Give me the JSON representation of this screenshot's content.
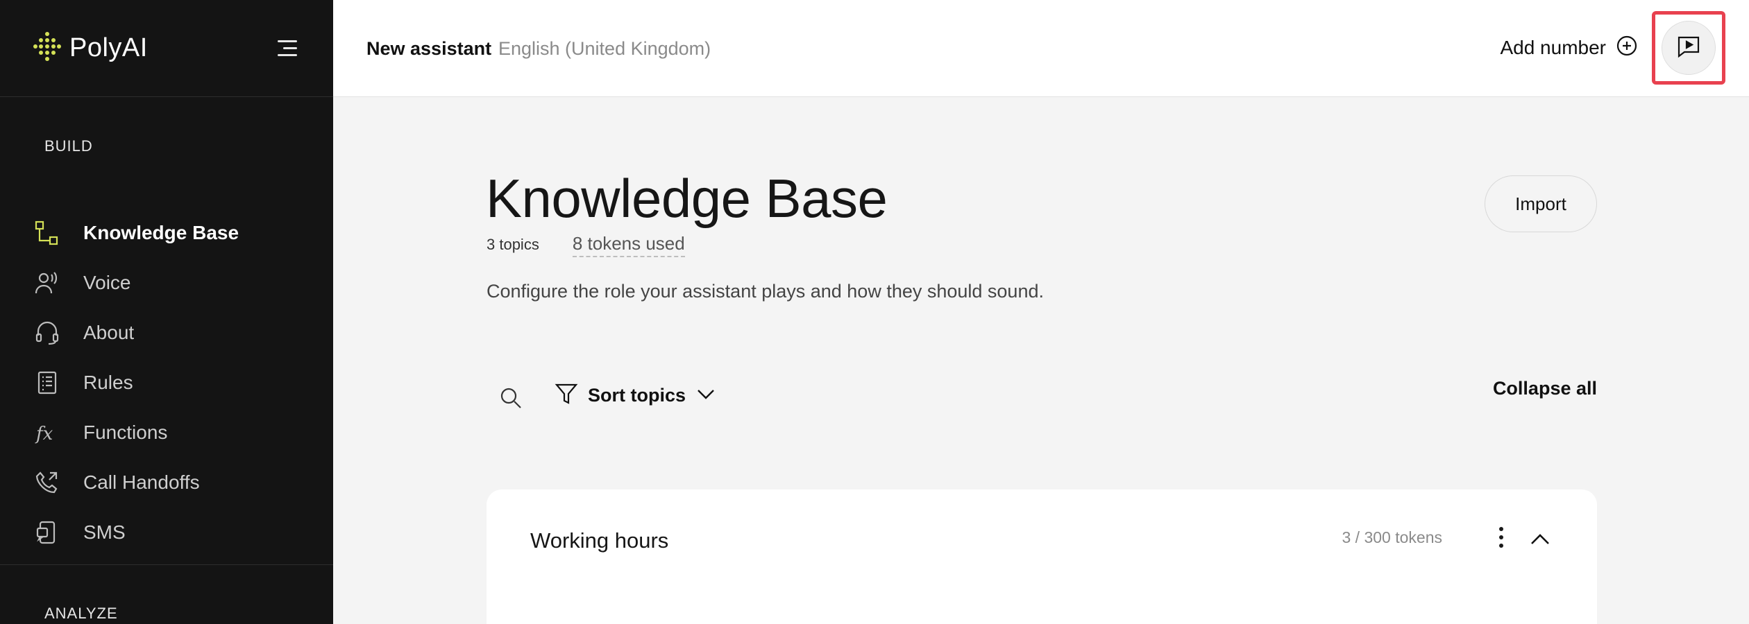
{
  "app": {
    "logo_text": "PolyAI"
  },
  "sidebar": {
    "build_title": "BUILD",
    "analyze_title": "ANALYZE",
    "items": [
      {
        "label": "Knowledge Base",
        "icon": "knowledge-base-icon",
        "active": true
      },
      {
        "label": "Voice",
        "icon": "voice-icon"
      },
      {
        "label": "About",
        "icon": "headset-icon"
      },
      {
        "label": "Rules",
        "icon": "rules-icon"
      },
      {
        "label": "Functions",
        "icon": "functions-icon"
      },
      {
        "label": "Call Handoffs",
        "icon": "phone-forward-icon"
      },
      {
        "label": "SMS",
        "icon": "sms-icon"
      }
    ]
  },
  "topbar": {
    "assistant_name": "New assistant",
    "language": "English (United Kingdom)",
    "add_number_label": "Add number"
  },
  "main": {
    "title": "Knowledge Base",
    "topics_count": "3 topics",
    "tokens_used": "8 tokens used",
    "description": "Configure the role your assistant plays and how they should sound.",
    "import_label": "Import",
    "sort_label": "Sort topics",
    "collapse_all_label": "Collapse all",
    "topics": [
      {
        "title": "Working hours",
        "tokens": "3 / 300 tokens"
      }
    ]
  },
  "colors": {
    "sidebar_bg": "#141414",
    "logo_accent": "#d4e157",
    "highlight": "#e8414f",
    "page_bg": "#f4f4f4"
  }
}
